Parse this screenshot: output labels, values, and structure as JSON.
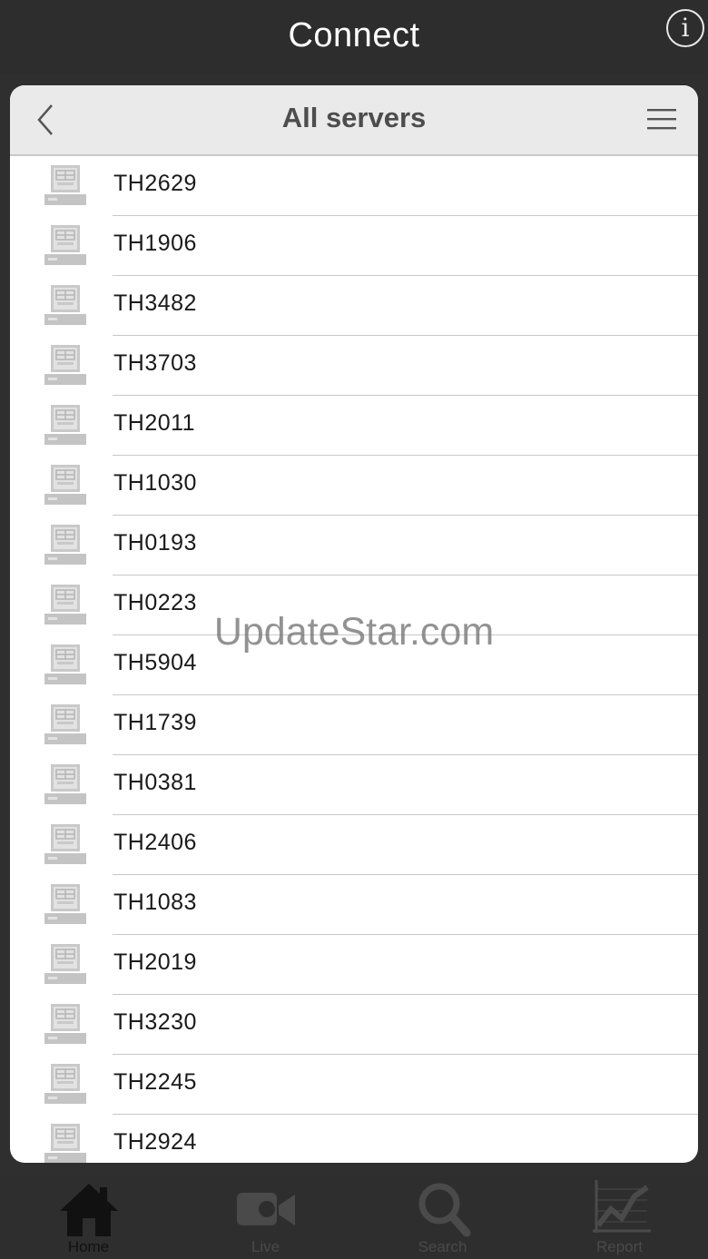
{
  "header": {
    "title": "Connect",
    "info_icon": "info-icon",
    "info_glyph": "i"
  },
  "panel": {
    "title": "All servers"
  },
  "servers": [
    {
      "name": "TH2629"
    },
    {
      "name": "TH1906"
    },
    {
      "name": "TH3482"
    },
    {
      "name": "TH3703"
    },
    {
      "name": "TH2011"
    },
    {
      "name": "TH1030"
    },
    {
      "name": "TH0193"
    },
    {
      "name": "TH0223"
    },
    {
      "name": "TH5904"
    },
    {
      "name": "TH1739"
    },
    {
      "name": "TH0381"
    },
    {
      "name": "TH2406"
    },
    {
      "name": "TH1083"
    },
    {
      "name": "TH2019"
    },
    {
      "name": "TH3230"
    },
    {
      "name": "TH2245"
    },
    {
      "name": "TH2924"
    }
  ],
  "watermark": "UpdateStar.com",
  "tabs": [
    {
      "label": "Home",
      "icon": "home-icon"
    },
    {
      "label": "Live",
      "icon": "video-camera-icon"
    },
    {
      "label": "Search",
      "icon": "search-icon"
    },
    {
      "label": "Report",
      "icon": "chart-icon"
    }
  ],
  "colors": {
    "topbar": "#2d2d2d",
    "panel_header": "#eaeaea",
    "separator": "#c8c8c8",
    "tabbar": "#2e2e2e"
  }
}
